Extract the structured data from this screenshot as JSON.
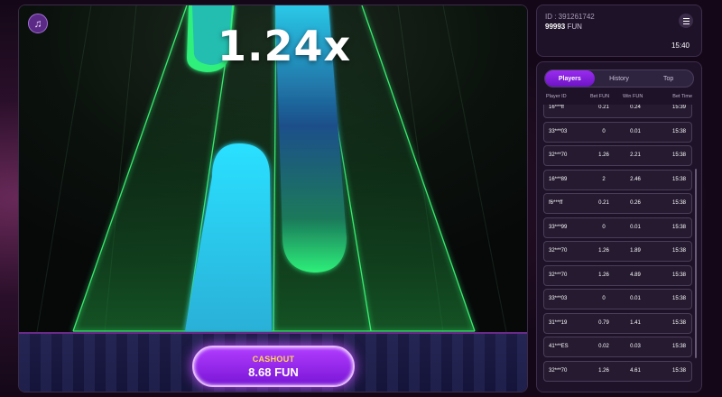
{
  "game": {
    "multiplier": "1.24x",
    "cashout": {
      "label": "CASHOUT",
      "amount": "8.68 FUN"
    },
    "music_icon": "music-note-icon"
  },
  "account": {
    "id_text": "ID : 391261742",
    "balance_value": "99993",
    "balance_unit": "FUN",
    "time": "15:40",
    "menu_icon": "hamburger-menu-icon"
  },
  "players": {
    "tabs": [
      {
        "label": "Players",
        "active": true
      },
      {
        "label": "History",
        "active": false
      },
      {
        "label": "Top",
        "active": false
      }
    ],
    "headers": {
      "player_id": "Player ID",
      "bet": "Bet  FUN",
      "win": "Win  FUN",
      "bet_time": "Bet Time"
    },
    "rows": [
      {
        "id": "16***ff",
        "bet": "0.21",
        "win": "0.24",
        "time": "15:39"
      },
      {
        "id": "33***03",
        "bet": "0",
        "win": "0.01",
        "time": "15:38"
      },
      {
        "id": "32***70",
        "bet": "1.26",
        "win": "2.21",
        "time": "15:38"
      },
      {
        "id": "16***89",
        "bet": "2",
        "win": "2.46",
        "time": "15:38"
      },
      {
        "id": "f6***ff",
        "bet": "0.21",
        "win": "0.26",
        "time": "15:38"
      },
      {
        "id": "33***99",
        "bet": "0",
        "win": "0.01",
        "time": "15:38"
      },
      {
        "id": "32***70",
        "bet": "1.26",
        "win": "1.89",
        "time": "15:38"
      },
      {
        "id": "32***70",
        "bet": "1.26",
        "win": "4.89",
        "time": "15:38"
      },
      {
        "id": "33***03",
        "bet": "0",
        "win": "0.01",
        "time": "15:38"
      },
      {
        "id": "31***19",
        "bet": "0.79",
        "win": "1.41",
        "time": "15:38"
      },
      {
        "id": "41***ES",
        "bet": "0.02",
        "win": "0.03",
        "time": "15:38"
      },
      {
        "id": "32***70",
        "bet": "1.26",
        "win": "4.61",
        "time": "15:38"
      }
    ]
  },
  "colors": {
    "accent_purple": "#9a2cf0",
    "cashout_gold": "#ffd84a",
    "lane_green": "#2bd96a",
    "pill_cyan": "#2ad8f5"
  }
}
